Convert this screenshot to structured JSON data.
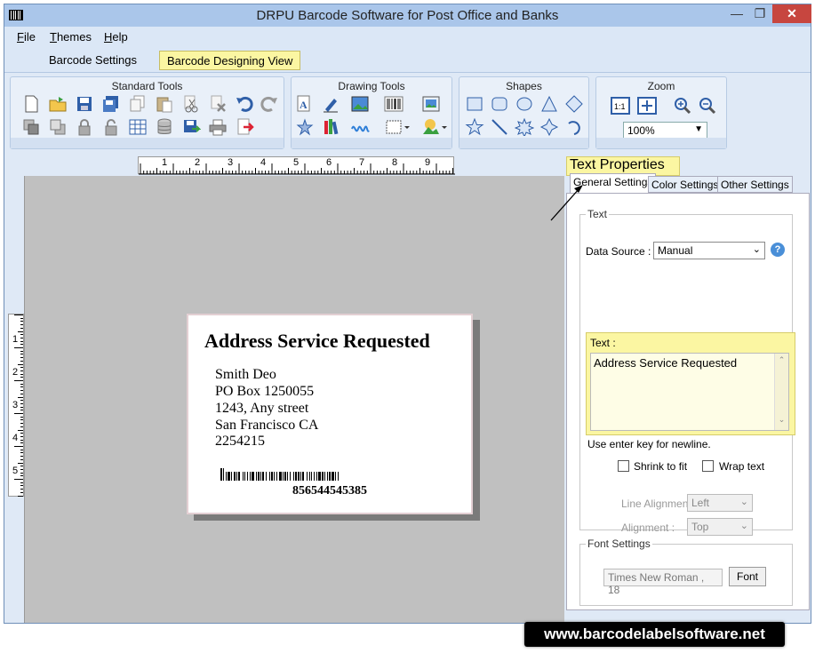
{
  "window": {
    "title": "DRPU Barcode Software for Post Office and Banks",
    "min_icon": "minimize-icon",
    "max_icon": "maximize-icon",
    "close_icon": "close-icon"
  },
  "menu": {
    "items": [
      {
        "label": "File",
        "key": "F",
        "rest": "ile"
      },
      {
        "label": "Themes",
        "key": "T",
        "rest": "hemes"
      },
      {
        "label": "Help",
        "key": "H",
        "rest": "elp"
      }
    ]
  },
  "ribbon_tabs": [
    {
      "label": "Barcode Settings",
      "active": false
    },
    {
      "label": "Barcode Designing View",
      "active": true
    }
  ],
  "ribbon": {
    "standard_tools": {
      "title": "Standard Tools",
      "icons": [
        "new-icon",
        "open-icon",
        "save-icon",
        "save-as-icon",
        "copy-icon",
        "paste-icon",
        "cut-icon",
        "delete-icon",
        "undo-icon",
        "redo-icon",
        "send-back-icon",
        "bring-front-icon",
        "lock-icon",
        "unlock-icon",
        "grid-icon",
        "database-icon",
        "export-icon",
        "print-icon",
        "exit-icon"
      ]
    },
    "drawing_tools": {
      "title": "Drawing Tools",
      "icons": [
        "text-icon",
        "pencil-icon",
        "picture-icon",
        "barcode-icon",
        "image-icon",
        "watermark-icon",
        "books-icon",
        "signature-icon",
        "rect-dropdown-icon",
        "fill-dropdown-icon"
      ]
    },
    "shapes": {
      "title": "Shapes",
      "icons": [
        "rectangle-icon",
        "rounded-rectangle-icon",
        "ellipse-icon",
        "triangle-icon",
        "diamond-icon",
        "star-icon",
        "line-icon",
        "burst-icon",
        "star4-icon",
        "arc-icon"
      ]
    },
    "zoom": {
      "title": "Zoom",
      "icons": [
        "actual-size-icon",
        "fit-icon",
        "zoom-in-icon",
        "zoom-out-icon"
      ],
      "value": "100%"
    }
  },
  "rulers": {
    "horizontal": [
      "1",
      "2",
      "3",
      "4",
      "5",
      "6",
      "7",
      "8",
      "9"
    ],
    "vertical": [
      "1",
      "2",
      "3",
      "4",
      "5"
    ]
  },
  "label": {
    "title": "Address Service Requested",
    "lines": [
      "Smith Deo",
      "PO Box 1250055",
      "1243, Any street",
      "San Francisco CA",
      "2254215"
    ],
    "barcode_number": "856544545385"
  },
  "properties": {
    "title": "Text Properties",
    "tabs": [
      "General Settings",
      "Color Settings",
      "Other Settings"
    ],
    "text_group": "Text",
    "data_source_label": "Data Source :",
    "data_source_value": "Manual",
    "help_icon": "help-icon",
    "text_label": "Text :",
    "text_value": "Address Service Requested",
    "newline_hint": "Use enter key for newline.",
    "shrink_to_fit": "Shrink to fit",
    "wrap_text": "Wrap text",
    "line_alignment_label": "Line Alignment :",
    "line_alignment_value": "Left",
    "alignment_label": "Alignment :",
    "alignment_value": "Top",
    "font_group": "Font Settings",
    "font_value": "Times New Roman , 18",
    "font_button": "Font"
  },
  "watermark": "www.barcodelabelsoftware.net"
}
